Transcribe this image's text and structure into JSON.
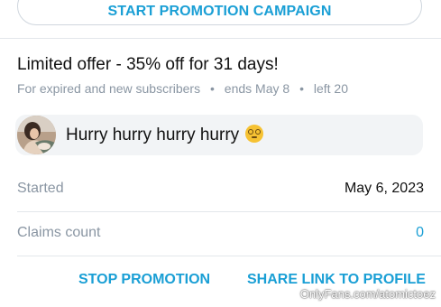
{
  "campaign_button": {
    "label": "START PROMOTION CAMPAIGN"
  },
  "offer": {
    "title": "Limited offer - 35% off for 31 days!",
    "audience": "For expired and new subscribers",
    "separator": "•",
    "ends": "ends May 8",
    "left": "left 20"
  },
  "message": {
    "text": "Hurry hurry hurry hurry",
    "emoji": "dizzy-face-icon"
  },
  "details": {
    "started_label": "Started",
    "started_value": "May 6, 2023",
    "claims_label": "Claims count",
    "claims_value": "0"
  },
  "actions": {
    "stop": "STOP PROMOTION",
    "share": "SHARE LINK TO PROFILE"
  },
  "watermark": "OnlyFans.com/atomictoez",
  "colors": {
    "accent": "#1a9fd5",
    "muted_text": "#8a96a3",
    "divider": "#e3e7eb",
    "message_bg": "#f2f4f6"
  }
}
